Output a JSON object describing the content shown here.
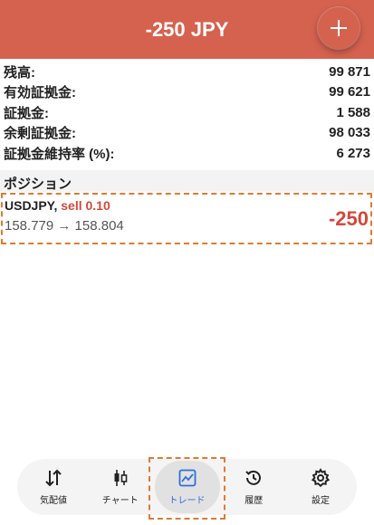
{
  "header": {
    "title": "-250 JPY"
  },
  "summary": [
    {
      "label": "残高:",
      "value": "99 871"
    },
    {
      "label": "有効証拠金:",
      "value": "99 621"
    },
    {
      "label": "証拠金:",
      "value": "1 588"
    },
    {
      "label": "余剰証拠金:",
      "value": "98 033"
    },
    {
      "label": "証拠金維持率 (%):",
      "value": "6 273"
    }
  ],
  "positions": {
    "section_title": "ポジション",
    "items": [
      {
        "symbol": "USDJPY,",
        "side": "sell 0.10",
        "prices": "158.779 → 158.804",
        "profit": "-250"
      }
    ]
  },
  "nav": {
    "items": [
      {
        "label": "気配値",
        "icon": "quotes-icon"
      },
      {
        "label": "チャート",
        "icon": "candlestick-icon"
      },
      {
        "label": "トレード",
        "icon": "trade-chart-icon"
      },
      {
        "label": "履歴",
        "icon": "history-icon"
      },
      {
        "label": "設定",
        "icon": "gear-icon"
      }
    ],
    "active": "トレード"
  },
  "colors": {
    "header": "#d5624f",
    "loss": "#d5483a",
    "active_nav": "#2f6fdb",
    "highlight_frame": "#e07b32"
  }
}
